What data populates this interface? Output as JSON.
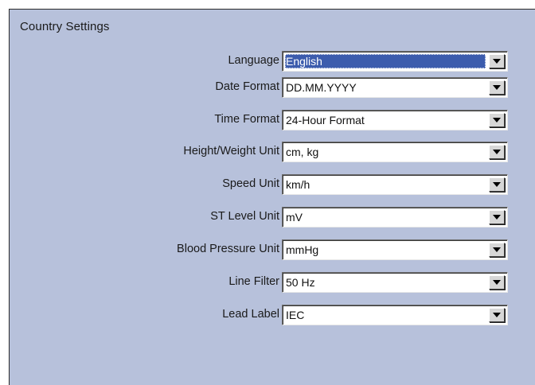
{
  "panel": {
    "title": "Country Settings"
  },
  "settings": [
    {
      "key": "language",
      "label": "Language",
      "value": "English",
      "selected": true
    },
    {
      "key": "date-format",
      "label": "Date Format",
      "value": "DD.MM.YYYY"
    },
    {
      "key": "time-format",
      "label": "Time Format",
      "value": "24-Hour Format"
    },
    {
      "key": "height-weight-unit",
      "label": "Height/Weight Unit",
      "value": "cm, kg"
    },
    {
      "key": "speed-unit",
      "label": "Speed Unit",
      "value": "km/h"
    },
    {
      "key": "st-level-unit",
      "label": "ST Level Unit",
      "value": "mV"
    },
    {
      "key": "blood-pressure-unit",
      "label": "Blood Pressure Unit",
      "value": "mmHg"
    },
    {
      "key": "line-filter",
      "label": "Line Filter",
      "value": "50 Hz"
    },
    {
      "key": "lead-label",
      "label": "Lead Label",
      "value": "IEC"
    }
  ],
  "colors": {
    "panel_background": "#b7c1db",
    "selection_highlight": "#3c5cad"
  },
  "icons": {
    "dropdown": "chevron-down-icon"
  }
}
